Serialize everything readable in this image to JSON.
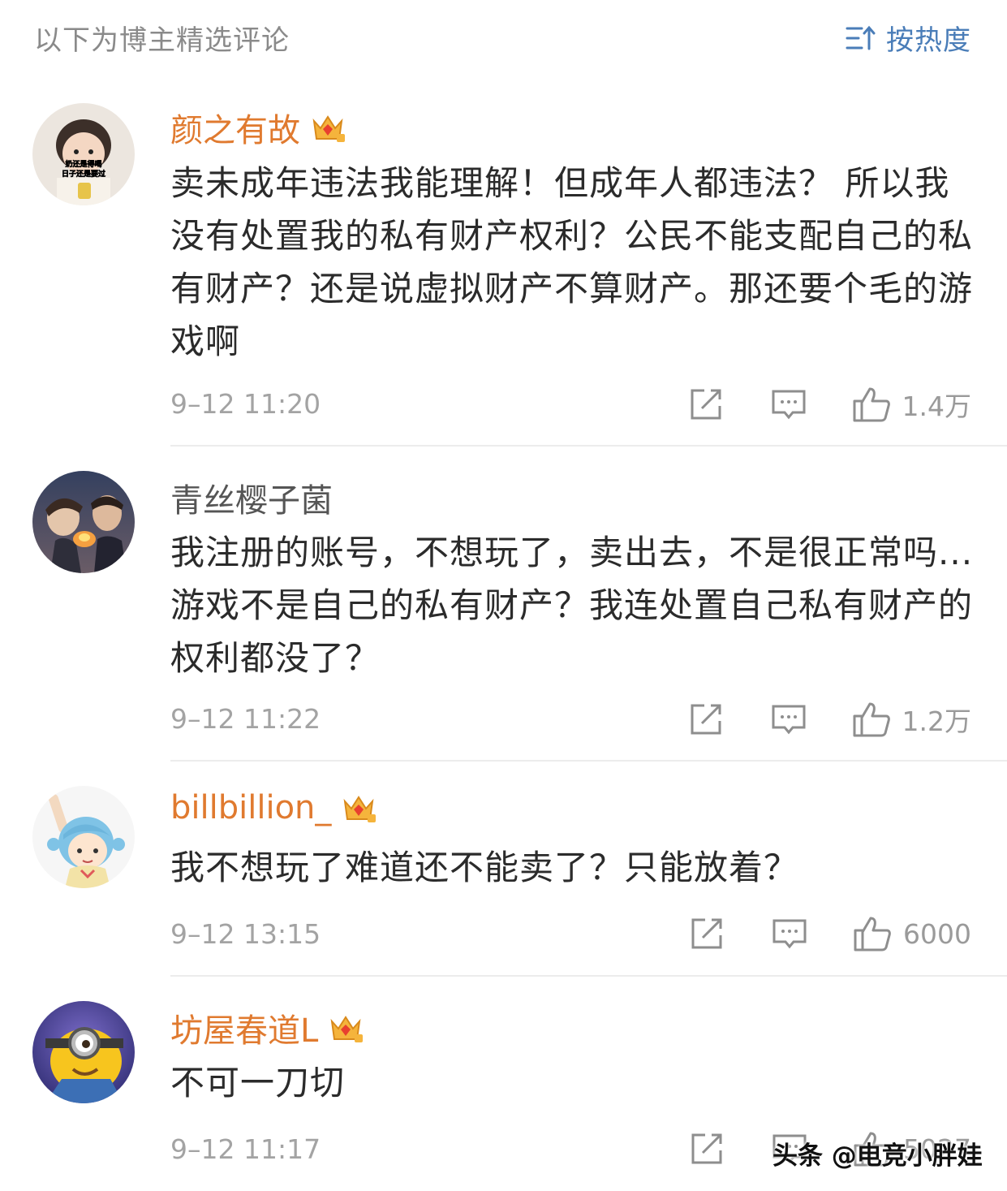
{
  "header": {
    "title": "以下为博主精选评论",
    "sort_label": "按热度",
    "sort_icon": "sort-icon"
  },
  "comments": [
    {
      "username": "颜之有故",
      "badge": true,
      "text": "卖未成年违法我能理解！但成年人都违法？  所以我没有处置我的私有财产权利？公民不能支配自己的私有财产？还是说虚拟财产不算财产。那还要个毛的游戏啊",
      "time": "9–12 11:20",
      "likes": "1.4万",
      "avatar_caption": "奶还是得喝 日子还是要过"
    },
    {
      "username": "青丝樱子菌",
      "badge": false,
      "text": "我注册的账号，不想玩了，卖出去，不是很正常吗...游戏不是自己的私有财产？我连处置自己私有财产的权利都没了？",
      "time": "9–12 11:22",
      "likes": "1.2万"
    },
    {
      "username": "billbillion_",
      "badge": true,
      "text": "我不想玩了难道还不能卖了？只能放着？",
      "time": "9–12 13:15",
      "likes": "6000"
    },
    {
      "username": "坊屋春道L",
      "badge": true,
      "text": "不可一刀切",
      "time": "9–12 11:17",
      "likes": "5027"
    }
  ],
  "watermark": "头条 @电竞小胖娃",
  "colors": {
    "vip_name": "#e07a2f",
    "accent": "#4a7db8",
    "muted": "#a3a3a3"
  }
}
